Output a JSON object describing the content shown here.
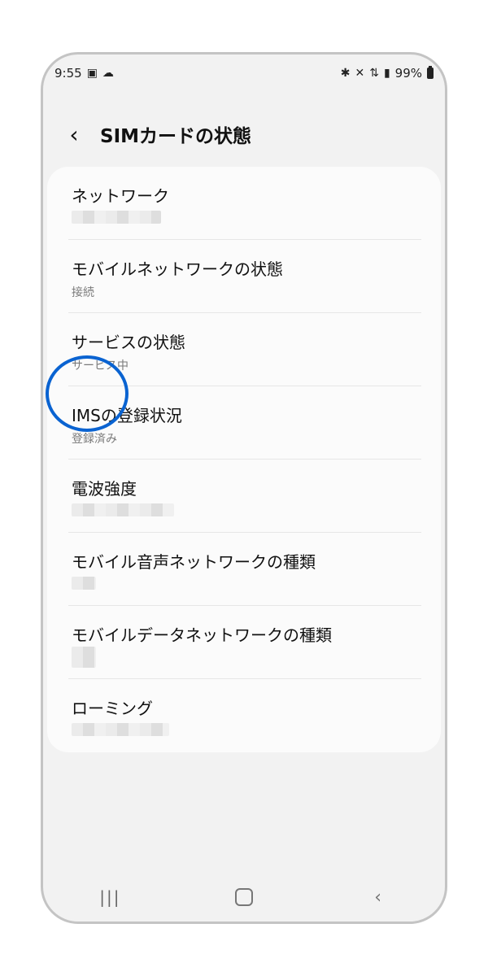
{
  "status_bar": {
    "time": "9:55",
    "left_icons": [
      "image-icon",
      "cloud-icon"
    ],
    "right_icons": [
      "bluetooth-icon",
      "mute-icon",
      "4g-icon",
      "signal-icon"
    ],
    "battery": "99%"
  },
  "header": {
    "title": "SIMカードの状態"
  },
  "items": [
    {
      "label": "ネットワーク",
      "sub": ""
    },
    {
      "label": "モバイルネットワークの状態",
      "sub": "接続"
    },
    {
      "label": "サービスの状態",
      "sub": "サービス中"
    },
    {
      "label": "IMSの登録状況",
      "sub": "登録済み"
    },
    {
      "label": "電波強度",
      "sub": ""
    },
    {
      "label": "モバイル音声ネットワークの種類",
      "sub": ""
    },
    {
      "label": "モバイルデータネットワークの種類",
      "sub": ""
    },
    {
      "label": "ローミング",
      "sub": ""
    }
  ],
  "navigation": {
    "icons": [
      "recents-icon",
      "home-icon",
      "back-icon"
    ]
  }
}
